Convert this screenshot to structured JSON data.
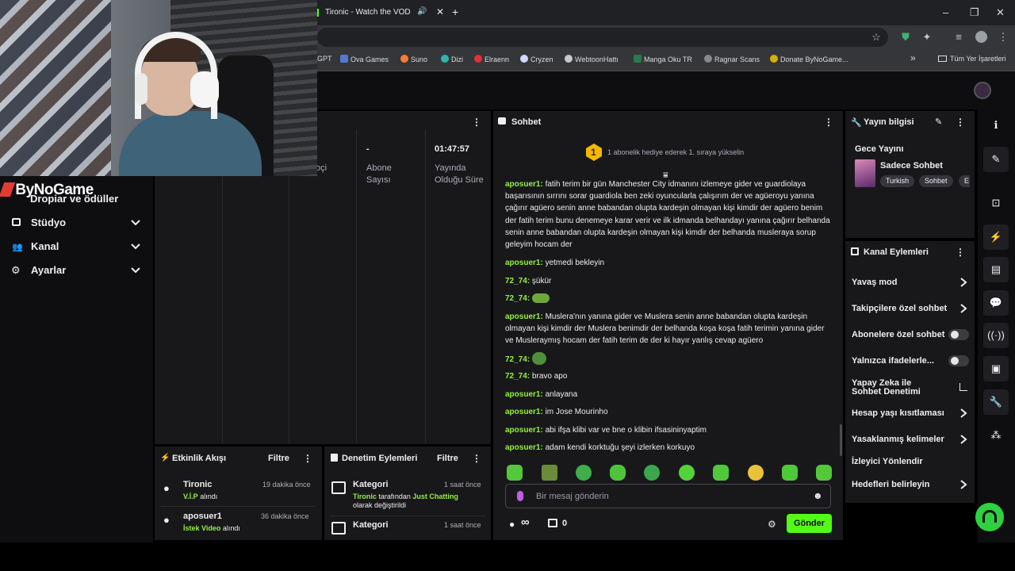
{
  "browser": {
    "tab_title": "Tironic - Watch the VOD on",
    "bookmarks": [
      {
        "label": "GPT"
      },
      {
        "label": "Ova Games"
      },
      {
        "label": "Suno"
      },
      {
        "label": "Dizi"
      },
      {
        "label": "Elraenn"
      },
      {
        "label": "Cryzen"
      },
      {
        "label": "WebtoonHattı"
      },
      {
        "label": "Manga Oku TR"
      },
      {
        "label": "Ragnar Scans"
      },
      {
        "label": "Donate ByNoGame..."
      }
    ],
    "all_bookmarks": "Tüm Yer İşaretleri",
    "overflow": "»"
  },
  "left_nav": {
    "logo": "ByNoGame",
    "partial_item": "Dropiar ve ödüller",
    "items": [
      {
        "label": "Stüdyo",
        "icon": "studio-icon"
      },
      {
        "label": "Kanal",
        "icon": "channel-icon"
      },
      {
        "label": "Ayarlar",
        "icon": "settings-icon"
      }
    ]
  },
  "stats": {
    "partial_label": "oçi",
    "subscribers_value": "-",
    "subscribers_label": "Abone Sayısı",
    "uptime_value": "01:47:57",
    "uptime_label": "Yayında Olduğu Süre"
  },
  "activity_feed": {
    "title": "Etkinlik Akışı",
    "filter": "Filtre",
    "items": [
      {
        "user": "Tironic",
        "time": "19 dakika önce",
        "highlight": "V.İ.P",
        "rest": " alındı"
      },
      {
        "user": "aposuer1",
        "time": "36 dakika önce",
        "highlight": "İstek Video",
        "rest": " alındı"
      }
    ]
  },
  "moderation": {
    "title": "Denetim Eylemleri",
    "filter": "Filtre",
    "items": [
      {
        "title": "Kategori",
        "time": "1 saat önce",
        "user": "Tironic",
        "mid": " tarafından ",
        "value": "Just Chatting",
        "rest": "olarak değiştirildi"
      },
      {
        "title": "Kategori",
        "time": "1 saat önce"
      }
    ]
  },
  "chat": {
    "title": "Sohbet",
    "gift_rank": "1",
    "gift_text": "1 abonelik hediye ederek 1. sıraya yükselin",
    "messages": [
      {
        "user": "aposuer1",
        "text": "fatih terim bir gün Manchester City idmanını izlemeye gider ve guardiolaya başarısının sırrını sorar guardiola ben zeki oyuncularla çalışırım der ve agüeroyu yanına çağırır agüero senin anne babandan olupta kardeşin olmayan kişi kimdir der agüero benim der fatih terim bunu denemeye karar verir ve ilk idmanda belhandayı yanına çağırır belhanda senin anne babandan olupta kardeşin olmayan kişi kimdir der belhanda musleraya sorup geleyim hocam der"
      },
      {
        "user": "aposuer1",
        "text": "yetmedi bekleyin"
      },
      {
        "user": "72_74",
        "text": "şükür"
      },
      {
        "user": "72_74",
        "text": ""
      },
      {
        "user": "aposuer1",
        "text": "Muslera'nın yanına gider ve Muslera senin anne babandan olupta kardeşin olmayan kişi kimdir der Muslera benimdir der belhanda koşa koşa fatih terimin yanına gider ve Musleraymış hocam der fatih terim de der ki hayır yanlış cevap agüero"
      },
      {
        "user": "72_74",
        "text": ""
      },
      {
        "user": "72_74",
        "text": "bravo apo"
      },
      {
        "user": "aposuer1",
        "text": "anlayana"
      },
      {
        "user": "aposuer1",
        "text": "im Jose Mourinho"
      },
      {
        "user": "aposuer1",
        "text": "abi ifşa klibi var ve bne o klibin ifsasininyaptim"
      },
      {
        "user": "aposuer1",
        "text": "adam kendi korktuğu şeyi izlerken korkuyo"
      }
    ],
    "input_placeholder": "Bir mesaj gönderin",
    "points": "∞",
    "gifts": "0",
    "send": "Gönder"
  },
  "stream_info": {
    "title": "Yayın bilgisi",
    "stream_title": "Gece Yayını",
    "category": "Sadece Sohbet",
    "tags": [
      "Turkish",
      "Sohbet",
      "E"
    ]
  },
  "channel_actions": {
    "title": "Kanal Eylemleri",
    "items": [
      {
        "label": "Yavaş mod",
        "control": "chevron"
      },
      {
        "label": "Takipçilere özel sohbet",
        "control": "chevron"
      },
      {
        "label": "Abonelere özel sohbet",
        "control": "toggle"
      },
      {
        "label": "Yalnızca ifadelerle...",
        "control": "toggle"
      },
      {
        "label": "Yapay Zeka ile Sohbet Denetimi",
        "control": "external"
      },
      {
        "label": "Hesap yaşı kısıtlaması",
        "control": "chevron"
      },
      {
        "label": "Yasaklanmış kelimeler",
        "control": "chevron"
      },
      {
        "label": "İzleyici Yönlendir",
        "control": "none"
      },
      {
        "label": "Hedefleri belirleyin",
        "control": "chevron"
      }
    ]
  },
  "colors": {
    "accent": "#53fc18",
    "username": "#94f040",
    "panel": "#18181b",
    "background": "#0e0e10"
  }
}
